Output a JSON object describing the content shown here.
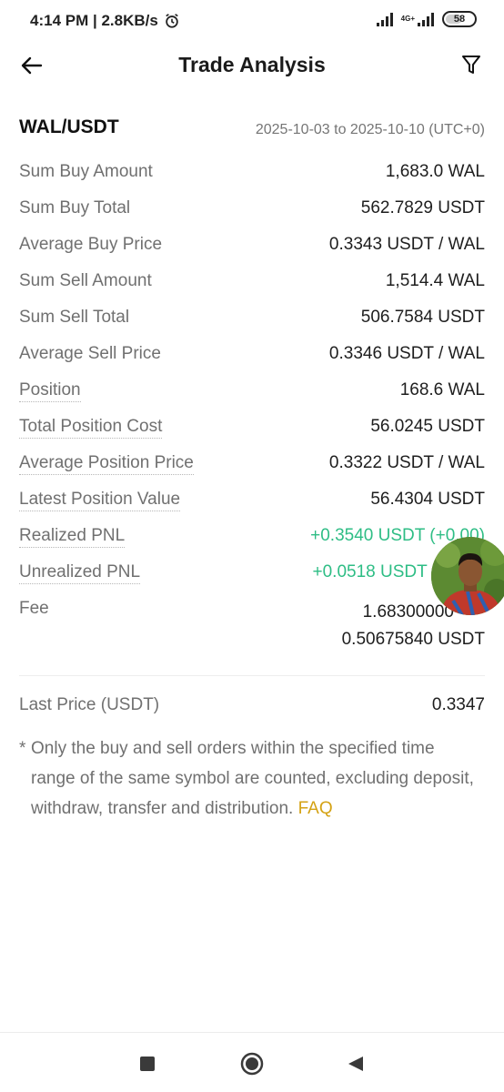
{
  "status_bar": {
    "time_speed": "4:14 PM | 2.8KB/s",
    "network_label": "4G+",
    "battery": "58"
  },
  "header": {
    "title": "Trade Analysis"
  },
  "summary": {
    "symbol": "WAL/USDT",
    "date_range": "2025-10-03 to 2025-10-10 (UTC+0)",
    "rows": [
      {
        "label": "Sum Buy Amount",
        "value": "1,683.0 WAL"
      },
      {
        "label": "Sum Buy Total",
        "value": "562.7829 USDT"
      },
      {
        "label": "Average Buy Price",
        "value": "0.3343 USDT / WAL"
      },
      {
        "label": "Sum Sell Amount",
        "value": "1,514.4 WAL"
      },
      {
        "label": "Sum Sell Total",
        "value": "506.7584 USDT"
      },
      {
        "label": "Average Sell Price",
        "value": "0.3346 USDT / WAL"
      },
      {
        "label": "Position",
        "value": "168.6 WAL"
      },
      {
        "label": "Total Position Cost",
        "value": "56.0245 USDT"
      },
      {
        "label": "Average Position Price",
        "value": "0.3322 USDT / WAL"
      },
      {
        "label": "Latest Position Value",
        "value": "56.4304 USDT"
      },
      {
        "label": "Realized PNL",
        "value": "+0.3540 USDT (+0.00)"
      },
      {
        "label": "Unrealized PNL",
        "value": "+0.0518 USDT ("
      }
    ],
    "fee": {
      "label": "Fee",
      "line1": "1.68300000",
      "line2": "0.50675840 USDT"
    },
    "last_price": {
      "label": "Last Price (USDT)",
      "value": "0.3347"
    },
    "note": {
      "star": "*",
      "text": "Only the buy and sell orders within the specified time range of the same symbol are counted, excluding deposit, withdraw, transfer and distribution.",
      "faq": "FAQ"
    }
  },
  "colors": {
    "positive": "#2ebd85",
    "link": "#d4a214",
    "label": "#707070"
  },
  "icons": {
    "back": "arrow-left-icon",
    "filter": "funnel-icon",
    "alarm": "alarm-clock-icon",
    "nav_recent": "square-icon",
    "nav_home": "circle-icon",
    "nav_back": "triangle-back-icon"
  }
}
